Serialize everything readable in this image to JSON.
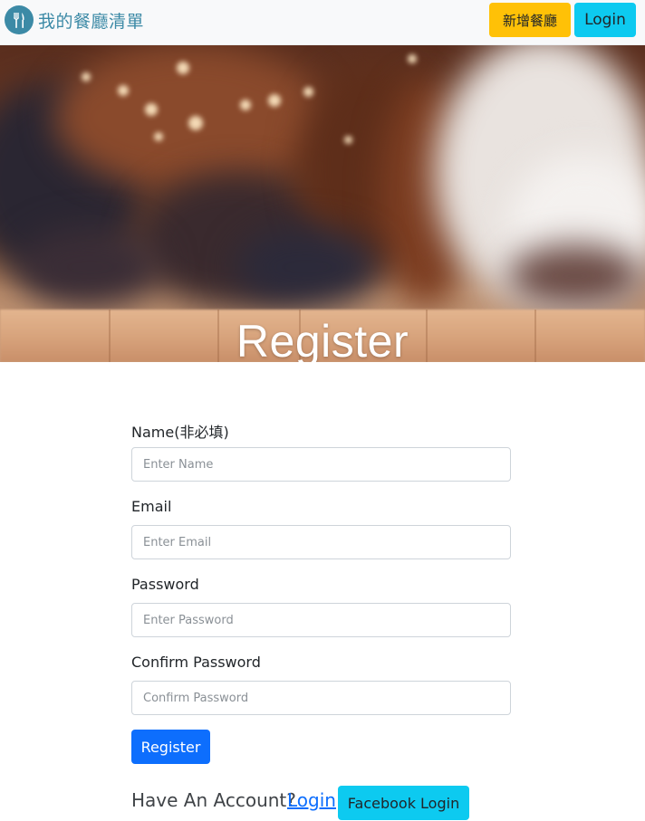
{
  "navbar": {
    "brand_text": "我的餐廳清單",
    "add_restaurant_label": "新增餐廳",
    "login_label": "Login"
  },
  "hero": {
    "title": "Register"
  },
  "form": {
    "name_label": "Name(非必填)",
    "name_placeholder": "Enter Name",
    "email_label": "Email",
    "email_placeholder": "Enter Email",
    "password_label": "Password",
    "password_placeholder": "Enter Password",
    "confirm_label": "Confirm Password",
    "confirm_placeholder": "Confirm Password",
    "register_label": "Register"
  },
  "footer": {
    "have_account_text": "Have An Account?",
    "login_link_text": "Login",
    "facebook_login_label": "Facebook Login"
  },
  "colors": {
    "brand": "#3c8aa6",
    "warning": "#ffc107",
    "info": "#0dcaf0",
    "primary": "#0d6efd"
  },
  "icons": {
    "brand_logo": "fork-knife-icon"
  }
}
